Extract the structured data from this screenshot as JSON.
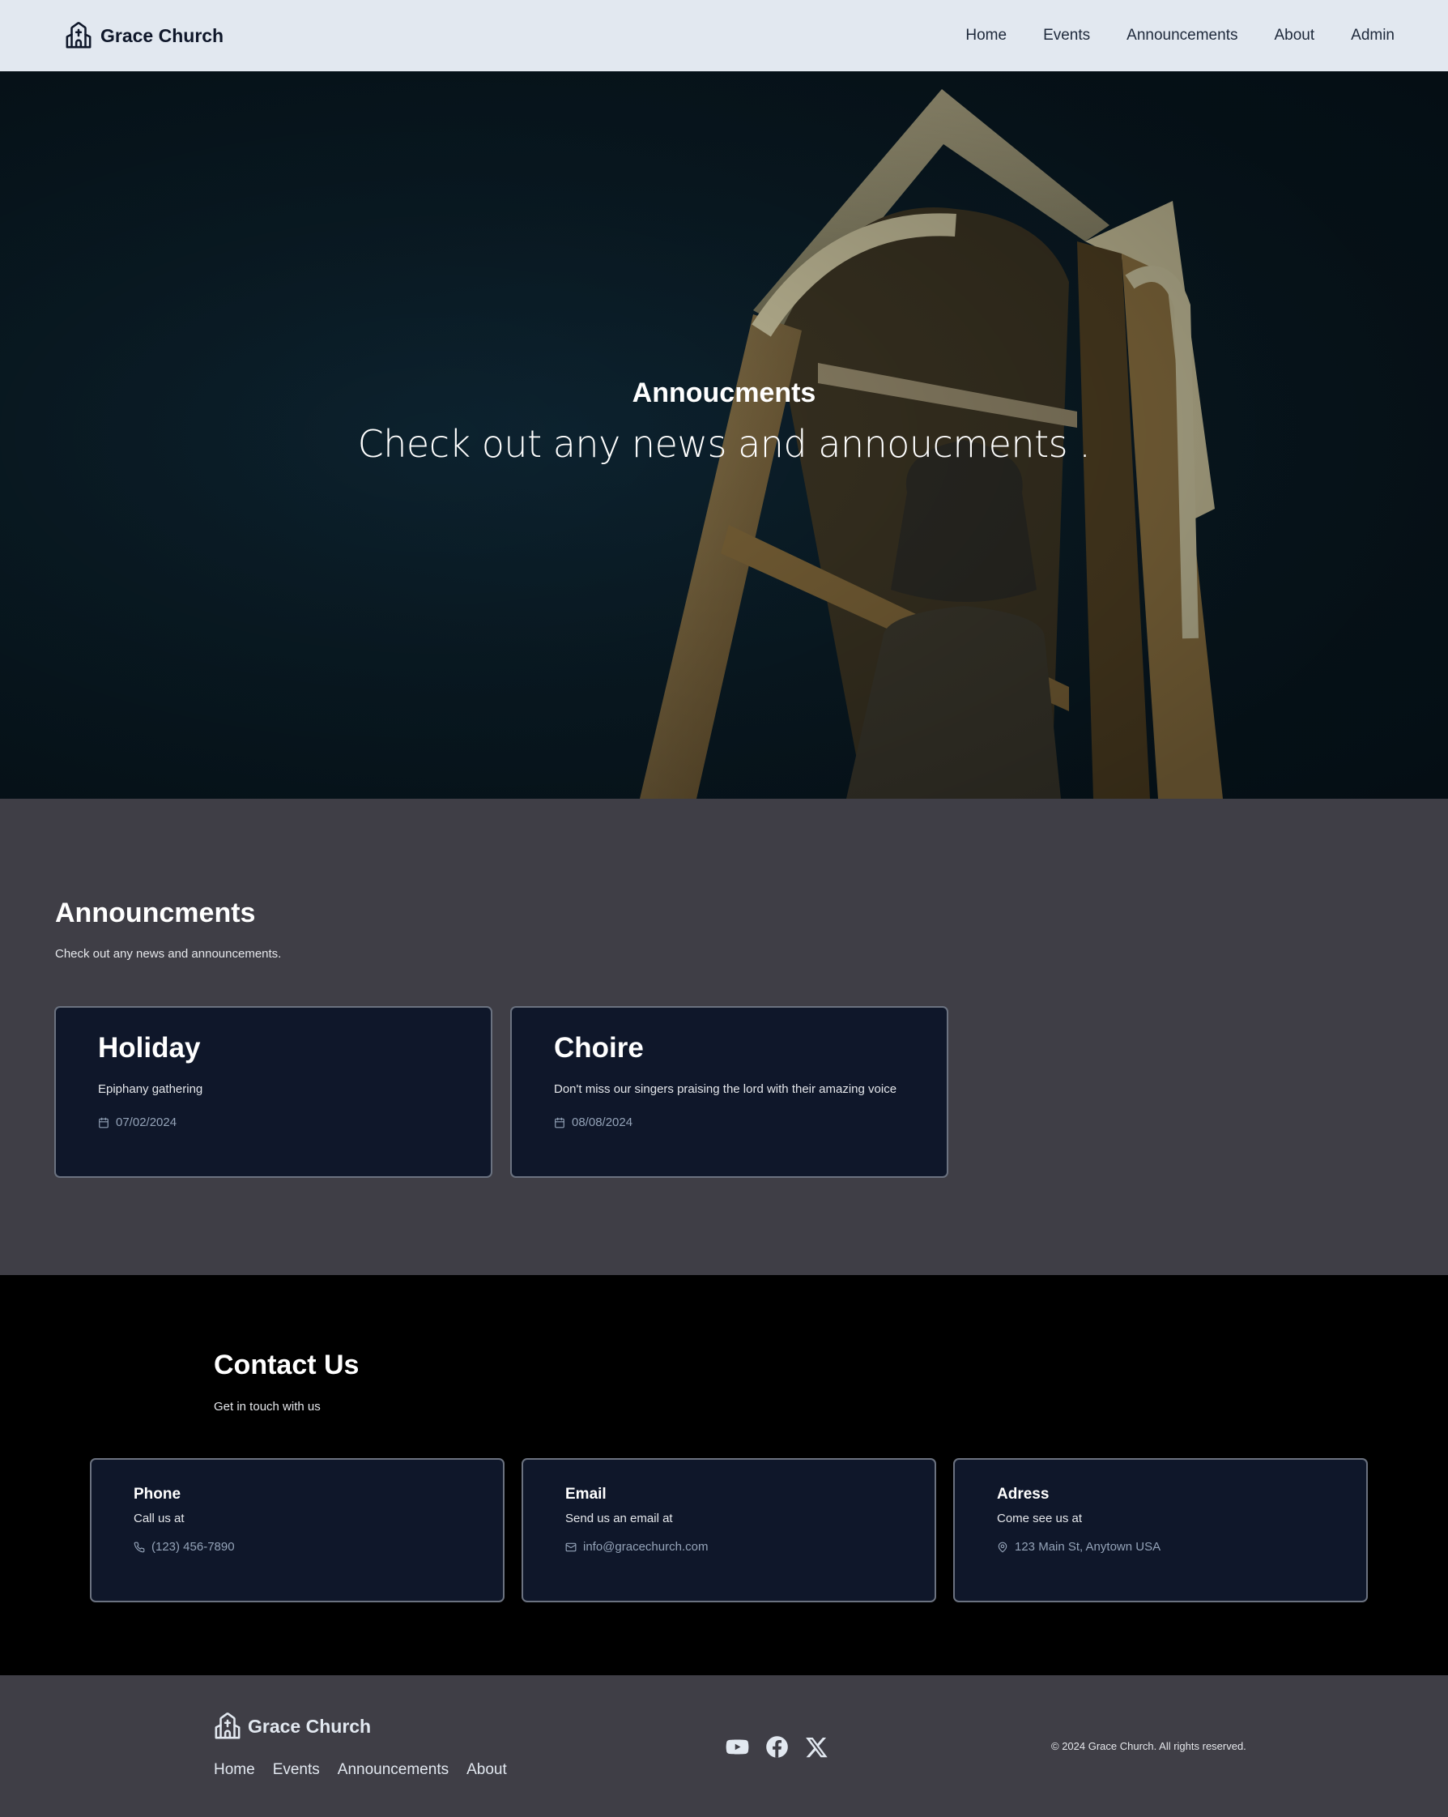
{
  "nav": {
    "brand": "Grace Church",
    "links": [
      "Home",
      "Events",
      "Announcements",
      "About",
      "Admin"
    ]
  },
  "hero": {
    "title": "Annoucments",
    "subtitle": "Check out any news and annoucments ."
  },
  "announcements": {
    "title": "Announcments",
    "subtitle": "Check out any news and announcements.",
    "cards": [
      {
        "title": "Holiday",
        "description": "Epiphany gathering",
        "date": "07/02/2024"
      },
      {
        "title": "Choire",
        "description": "Don't miss our singers praising the lord with their amazing voice",
        "date": "08/08/2024"
      }
    ]
  },
  "contact": {
    "title": "Contact Us",
    "subtitle": "Get in touch with us",
    "cards": [
      {
        "title": "Phone",
        "description": "Call us at",
        "detail": "(123) 456-7890",
        "icon": "phone-icon"
      },
      {
        "title": "Email",
        "description": "Send us an email at",
        "detail": "info@gracechurch.com",
        "icon": "mail-icon"
      },
      {
        "title": "Adress",
        "description": "Come see us at",
        "detail": "123 Main St, Anytown USA",
        "icon": "map-pin-icon"
      }
    ]
  },
  "footer": {
    "brand": "Grace Church",
    "links": [
      "Home",
      "Events",
      "Announcements",
      "About"
    ],
    "socials": [
      "youtube-icon",
      "facebook-icon",
      "x-icon"
    ],
    "copyright": "© 2024 Grace Church. All rights reserved."
  },
  "colors": {
    "nav_bg": "#e2e8f0",
    "section_bg": "#3f3e46",
    "card_bg": "#0f172a",
    "contact_bg": "#000000",
    "muted_text": "#94a3b8"
  }
}
